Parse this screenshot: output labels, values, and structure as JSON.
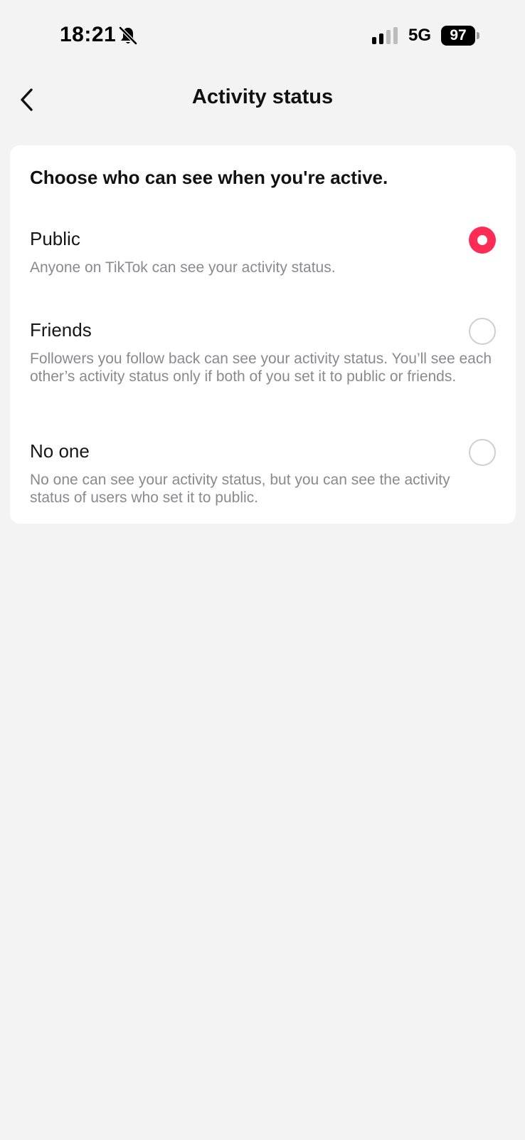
{
  "status_bar": {
    "time": "18:21",
    "network": "5G",
    "battery": "97",
    "icons": [
      "bell-muted-icon",
      "cellular-signal-icon",
      "battery-icon"
    ]
  },
  "header": {
    "title": "Activity status",
    "back_icon": "chevron-left-icon"
  },
  "card": {
    "heading": "Choose who can see when you're active."
  },
  "options": [
    {
      "label": "Public",
      "description": "Anyone on TikTok can see your activity status.",
      "selected": true
    },
    {
      "label": "Friends",
      "description": "Followers you follow back can see your activity status. You’ll see each other’s activity status only if both of you set it to public or friends.",
      "selected": false
    },
    {
      "label": "No one",
      "description": "No one can see your activity status, but you can see the activity status of users who set it to public.",
      "selected": false
    }
  ],
  "colors": {
    "accent": "#fe2c55",
    "background": "#f3f3f4",
    "card": "#ffffff",
    "secondary_text": "#8a8a8e"
  }
}
